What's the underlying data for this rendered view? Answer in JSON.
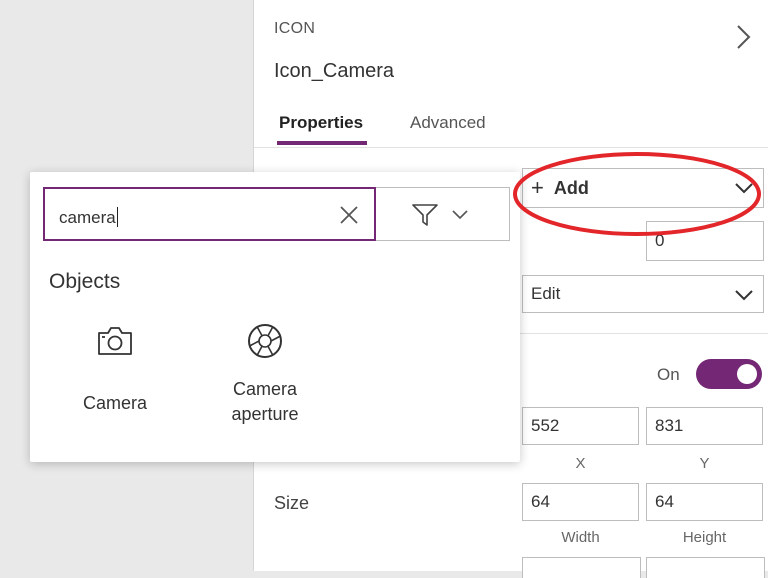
{
  "panel": {
    "control_type": "ICON",
    "control_name": "Icon_Camera",
    "tabs": [
      {
        "label": "Properties",
        "active": true
      },
      {
        "label": "Advanced",
        "active": false
      }
    ],
    "add_dropdown": {
      "plus": "+",
      "label": "Add"
    },
    "numeric_value": "0",
    "mode_dropdown": {
      "value": "Edit"
    },
    "toggle": {
      "label": "On",
      "state": "on"
    },
    "position": {
      "x": "552",
      "y": "831",
      "x_caption": "X",
      "y_caption": "Y"
    },
    "size": {
      "label": "Size",
      "width": "64",
      "height": "64",
      "width_caption": "Width",
      "height_caption": "Height"
    }
  },
  "popup": {
    "search_value": "camera",
    "section_heading": "Objects",
    "results": [
      {
        "label": "Camera",
        "icon": "camera-icon"
      },
      {
        "label_line1": "Camera",
        "label_line2": "aperture",
        "icon": "camera-aperture-icon"
      }
    ]
  },
  "colors": {
    "accent": "#742774",
    "annotation": "#e3262a"
  }
}
